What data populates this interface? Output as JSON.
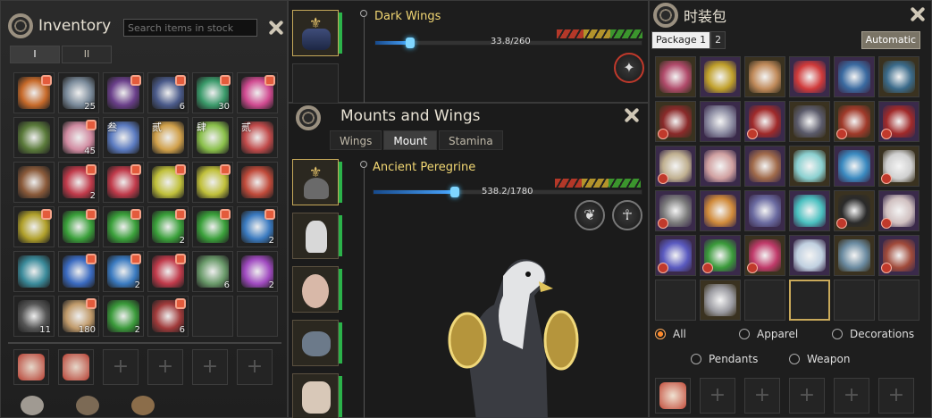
{
  "inventory": {
    "title": "Inventory",
    "search_placeholder": "Search items in stock",
    "tabs": [
      "I",
      "II"
    ],
    "quantities": {
      "r1c2": "25",
      "r1c4": "6",
      "r1c5": "30",
      "r2c2": "45",
      "r3c2": "2",
      "r4c4": "2",
      "r4c6": "2",
      "r5c3": "2",
      "r5c5": "6",
      "r5c6": "2",
      "r6c1": "11",
      "r6c2": "180",
      "r6c3": "2",
      "r6c4": "6"
    },
    "grid_labels": {
      "r2c3": "叁",
      "r2c4": "贰",
      "r2c5": "肆",
      "r2c6": "贰"
    }
  },
  "wings": {
    "item_name": "Dark Wings",
    "progress_text": "33.8/260",
    "progress": 0.13
  },
  "mounts": {
    "title": "Mounts and Wings",
    "tabs": [
      "Wings",
      "Mount",
      "Stamina"
    ],
    "active_tab": "Mount",
    "item_name": "Ancient Peregrine",
    "progress_text": "538.2/1780",
    "progress": 0.3
  },
  "fashion": {
    "title": "时装包",
    "package_tabs": [
      "Package 1",
      "2"
    ],
    "auto_button": "Automatic",
    "filters": [
      "All",
      "Apparel",
      "Decorations",
      "Pendants",
      "Weapon"
    ],
    "selected_filter": "All"
  },
  "colors": {
    "accent_gold": "#f2d773",
    "health_green": "#2bb34a",
    "lock_red": "#e35b3c",
    "xp_blue": "#4aa6ff"
  }
}
